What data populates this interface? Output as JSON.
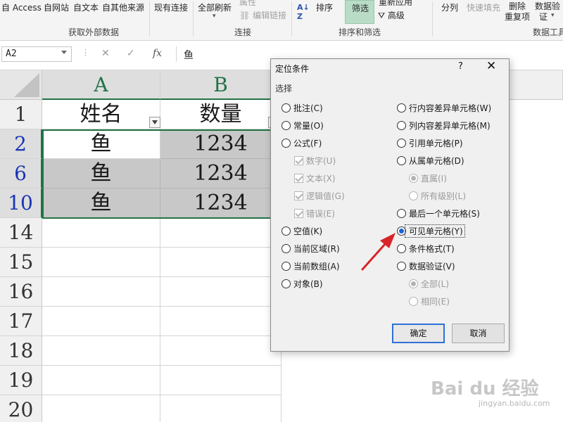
{
  "ribbon": {
    "items": {
      "access": "自 Access",
      "web": "自网站",
      "text": "自文本",
      "other": "自其他来源",
      "existing": "现有连接",
      "refresh_all": "全部刷新",
      "props_cut": "属性",
      "edit_links": "编辑链接",
      "sort": "排序",
      "filter": "筛选",
      "reapply_cut": "重新应用",
      "advanced": "高级",
      "split": "分列",
      "flash_fill": "快速填充",
      "remove_dup_1": "删除",
      "remove_dup_2": "重复项",
      "validation_1": "数据验",
      "validation_2": "证"
    },
    "groups": {
      "external": "获取外部数据",
      "connections": "连接",
      "sort_filter": "排序和筛选",
      "data_tools": "数据工具"
    }
  },
  "formula_bar": {
    "namebox": "A2",
    "content": "鱼"
  },
  "grid": {
    "columns": [
      "A",
      "B"
    ],
    "rows": [
      {
        "num": "1",
        "a": "姓名",
        "b": "数量"
      },
      {
        "num": "2",
        "a": "鱼",
        "b": "1234"
      },
      {
        "num": "6",
        "a": "鱼",
        "b": "1234"
      },
      {
        "num": "10",
        "a": "鱼",
        "b": "1234"
      },
      {
        "num": "14",
        "a": "",
        "b": ""
      },
      {
        "num": "15",
        "a": "",
        "b": ""
      },
      {
        "num": "16",
        "a": "",
        "b": ""
      },
      {
        "num": "17",
        "a": "",
        "b": ""
      },
      {
        "num": "18",
        "a": "",
        "b": ""
      },
      {
        "num": "19",
        "a": "",
        "b": ""
      },
      {
        "num": "20",
        "a": "",
        "b": ""
      }
    ]
  },
  "dialog": {
    "title": "定位条件",
    "help": "?",
    "close": "✕",
    "section": "选择",
    "left": [
      {
        "label": "批注(C)"
      },
      {
        "label": "常量(O)"
      },
      {
        "label": "公式(F)"
      },
      {
        "label": "数字(U)"
      },
      {
        "label": "文本(X)"
      },
      {
        "label": "逻辑值(G)"
      },
      {
        "label": "错误(E)"
      },
      {
        "label": "空值(K)"
      },
      {
        "label": "当前区域(R)"
      },
      {
        "label": "当前数组(A)"
      },
      {
        "label": "对象(B)"
      }
    ],
    "right": [
      {
        "label": "行内容差异单元格(W)"
      },
      {
        "label": "列内容差异单元格(M)"
      },
      {
        "label": "引用单元格(P)"
      },
      {
        "label": "从属单元格(D)"
      },
      {
        "label": "直属(I)"
      },
      {
        "label": "所有级别(L)"
      },
      {
        "label": "最后一个单元格(S)"
      },
      {
        "label": "可见单元格(Y)"
      },
      {
        "label": "条件格式(T)"
      },
      {
        "label": "数据验证(V)"
      },
      {
        "label": "全部(L)"
      },
      {
        "label": "相同(E)"
      }
    ],
    "ok": "确定",
    "cancel": "取消"
  },
  "watermark": {
    "logo": "Bai du 经验",
    "url": "jingyan.baidu.com"
  },
  "colors": {
    "excel_green": "#217346",
    "selected_radio": "#1a64d4",
    "hidden_rows_fill": "#c8c8c8",
    "arrow": "#d9232a"
  }
}
